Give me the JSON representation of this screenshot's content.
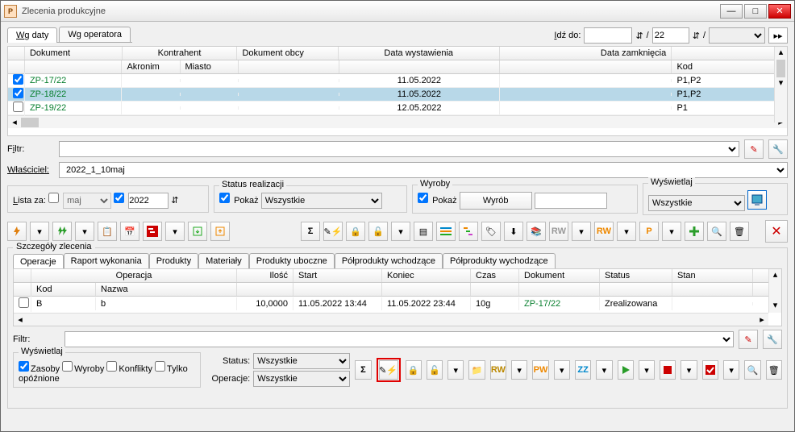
{
  "window": {
    "title": "Zlecenia produkcyjne"
  },
  "tabs": {
    "wg_daty": "Wg daty",
    "wg_operatora": "Wg operatora"
  },
  "goto": {
    "label": "Idź do:",
    "field1": "",
    "sep": "/",
    "field2": "22",
    "combo": ""
  },
  "gridhead": {
    "dokument": "Dokument",
    "kontrahent": "Kontrahent",
    "akronim": "Akronim",
    "miasto": "Miasto",
    "dok_obcy": "Dokument obcy",
    "data_wyst": "Data wystawienia",
    "data_zamk": "Data zamknięcia",
    "kod": "Kod"
  },
  "rows": [
    {
      "chk": true,
      "doc": "ZP-17/22",
      "dwys": "11.05.2022",
      "kod": "P1,P2"
    },
    {
      "chk": true,
      "doc": "ZP-18/22",
      "dwys": "11.05.2022",
      "kod": "P1,P2"
    },
    {
      "chk": false,
      "doc": "ZP-19/22",
      "dwys": "12.05.2022",
      "kod": "P1"
    }
  ],
  "filtr": {
    "label": "Filtr:",
    "value": ""
  },
  "wlasciciel": {
    "label": "Właściciel:",
    "value": "2022_1_10maj"
  },
  "lista_za": {
    "label": "Lista za:",
    "chk_month": false,
    "month": "maj",
    "chk_year": true,
    "year": "2022"
  },
  "status_real": {
    "title": "Status realizacji",
    "pokaz": "Pokaż",
    "sel": "Wszystkie"
  },
  "wyroby": {
    "title": "Wyroby",
    "pokaz": "Pokaż",
    "btn": "Wyrób",
    "val": ""
  },
  "wyswietlaj": {
    "title": "Wyświetlaj",
    "sel": "Wszystkie"
  },
  "details": {
    "legend": "Szczegóły zlecenia",
    "tabs": [
      "Operacje",
      "Raport wykonania",
      "Produkty",
      "Materiały",
      "Produkty uboczne",
      "Półprodukty wchodzące",
      "Półprodukty wychodzące"
    ],
    "head": {
      "operacja": "Operacja",
      "kod": "Kod",
      "nazwa": "Nazwa",
      "ilosc": "Ilość",
      "start": "Start",
      "koniec": "Koniec",
      "czas": "Czas",
      "dokument": "Dokument",
      "status": "Status",
      "stan": "Stan"
    },
    "row": {
      "kod": "B",
      "nazwa": "b",
      "ilosc": "10,0000",
      "start": "11.05.2022 13:44",
      "koniec": "11.05.2022 23:44",
      "czas": "10g",
      "dok": "ZP-17/22",
      "status": "Zrealizowana",
      "stan": ""
    }
  },
  "filtr2": {
    "label": "Filtr:",
    "value": ""
  },
  "bottom": {
    "wyswietlaj": "Wyświetlaj",
    "zasoby": "Zasoby",
    "wyr": "Wyroby",
    "konf": "Konflikty",
    "opoz": "Tylko opóźnione",
    "status_lab": "Status:",
    "status_sel": "Wszystkie",
    "oper_lab": "Operacje:",
    "oper_sel": "Wszystkie"
  }
}
